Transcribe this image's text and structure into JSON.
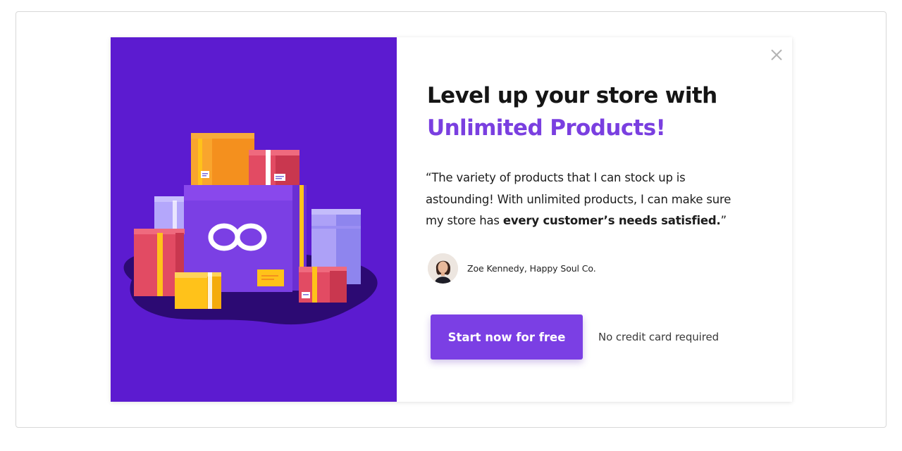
{
  "modal": {
    "headline_line1": "Level up your store with",
    "headline_line2": "Unlimited Products!",
    "quote_part1": "“The variety of products that I can stock up is astounding! With unlimited products, I can make sure my store has ",
    "quote_bold": "every customer’s needs satisfied.",
    "quote_end": "”",
    "author_name": "Zoe Kennedy, Happy Soul Co.",
    "cta_label": "Start now for free",
    "cta_note": "No credit card required",
    "close_icon": "close-icon",
    "illustration_icon": "infinity-icon"
  },
  "colors": {
    "illustration_background": "#5c1bd0",
    "accent": "#7b3fe4",
    "headline_highlight": "#7a3fe0",
    "headline_text": "#151515"
  }
}
